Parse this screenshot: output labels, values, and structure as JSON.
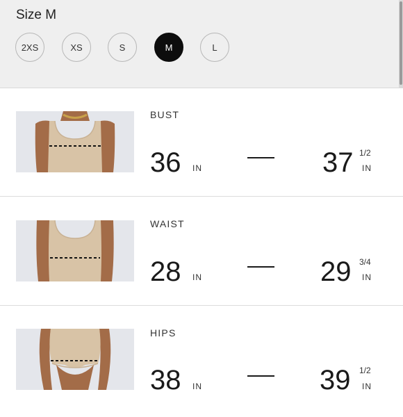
{
  "size_selector": {
    "title": "Size M",
    "options": [
      "2XS",
      "XS",
      "S",
      "M",
      "L"
    ],
    "selected": "M"
  },
  "measurements": [
    {
      "label": "BUST",
      "min": "36",
      "min_unit": "IN",
      "max": "37",
      "max_fraction": "1/2",
      "max_unit": "IN"
    },
    {
      "label": "WAIST",
      "min": "28",
      "min_unit": "IN",
      "max": "29",
      "max_fraction": "3/4",
      "max_unit": "IN"
    },
    {
      "label": "HIPS",
      "min": "38",
      "min_unit": "IN",
      "max": "39",
      "max_fraction": "1/2",
      "max_unit": "IN"
    }
  ],
  "colors": {
    "header_bg": "#efefef",
    "selected_chip": "#0d0d0d",
    "garment": "#d8c3a6",
    "skin": "#a36c48"
  },
  "icons": [
    "bust-measure-image",
    "waist-measure-image",
    "hips-measure-image"
  ]
}
